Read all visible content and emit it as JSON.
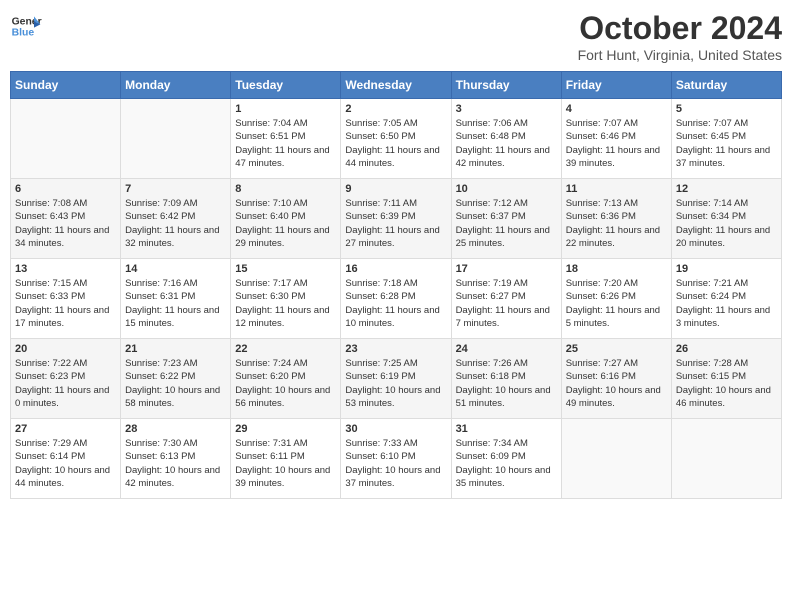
{
  "header": {
    "logo_line1": "General",
    "logo_line2": "Blue",
    "month": "October 2024",
    "location": "Fort Hunt, Virginia, United States"
  },
  "days_of_week": [
    "Sunday",
    "Monday",
    "Tuesday",
    "Wednesday",
    "Thursday",
    "Friday",
    "Saturday"
  ],
  "weeks": [
    [
      {
        "day": "",
        "empty": true
      },
      {
        "day": "",
        "empty": true
      },
      {
        "day": "1",
        "sunrise": "7:04 AM",
        "sunset": "6:51 PM",
        "daylight": "11 hours and 47 minutes."
      },
      {
        "day": "2",
        "sunrise": "7:05 AM",
        "sunset": "6:50 PM",
        "daylight": "11 hours and 44 minutes."
      },
      {
        "day": "3",
        "sunrise": "7:06 AM",
        "sunset": "6:48 PM",
        "daylight": "11 hours and 42 minutes."
      },
      {
        "day": "4",
        "sunrise": "7:07 AM",
        "sunset": "6:46 PM",
        "daylight": "11 hours and 39 minutes."
      },
      {
        "day": "5",
        "sunrise": "7:07 AM",
        "sunset": "6:45 PM",
        "daylight": "11 hours and 37 minutes."
      }
    ],
    [
      {
        "day": "6",
        "sunrise": "7:08 AM",
        "sunset": "6:43 PM",
        "daylight": "11 hours and 34 minutes."
      },
      {
        "day": "7",
        "sunrise": "7:09 AM",
        "sunset": "6:42 PM",
        "daylight": "11 hours and 32 minutes."
      },
      {
        "day": "8",
        "sunrise": "7:10 AM",
        "sunset": "6:40 PM",
        "daylight": "11 hours and 29 minutes."
      },
      {
        "day": "9",
        "sunrise": "7:11 AM",
        "sunset": "6:39 PM",
        "daylight": "11 hours and 27 minutes."
      },
      {
        "day": "10",
        "sunrise": "7:12 AM",
        "sunset": "6:37 PM",
        "daylight": "11 hours and 25 minutes."
      },
      {
        "day": "11",
        "sunrise": "7:13 AM",
        "sunset": "6:36 PM",
        "daylight": "11 hours and 22 minutes."
      },
      {
        "day": "12",
        "sunrise": "7:14 AM",
        "sunset": "6:34 PM",
        "daylight": "11 hours and 20 minutes."
      }
    ],
    [
      {
        "day": "13",
        "sunrise": "7:15 AM",
        "sunset": "6:33 PM",
        "daylight": "11 hours and 17 minutes."
      },
      {
        "day": "14",
        "sunrise": "7:16 AM",
        "sunset": "6:31 PM",
        "daylight": "11 hours and 15 minutes."
      },
      {
        "day": "15",
        "sunrise": "7:17 AM",
        "sunset": "6:30 PM",
        "daylight": "11 hours and 12 minutes."
      },
      {
        "day": "16",
        "sunrise": "7:18 AM",
        "sunset": "6:28 PM",
        "daylight": "11 hours and 10 minutes."
      },
      {
        "day": "17",
        "sunrise": "7:19 AM",
        "sunset": "6:27 PM",
        "daylight": "11 hours and 7 minutes."
      },
      {
        "day": "18",
        "sunrise": "7:20 AM",
        "sunset": "6:26 PM",
        "daylight": "11 hours and 5 minutes."
      },
      {
        "day": "19",
        "sunrise": "7:21 AM",
        "sunset": "6:24 PM",
        "daylight": "11 hours and 3 minutes."
      }
    ],
    [
      {
        "day": "20",
        "sunrise": "7:22 AM",
        "sunset": "6:23 PM",
        "daylight": "11 hours and 0 minutes."
      },
      {
        "day": "21",
        "sunrise": "7:23 AM",
        "sunset": "6:22 PM",
        "daylight": "10 hours and 58 minutes."
      },
      {
        "day": "22",
        "sunrise": "7:24 AM",
        "sunset": "6:20 PM",
        "daylight": "10 hours and 56 minutes."
      },
      {
        "day": "23",
        "sunrise": "7:25 AM",
        "sunset": "6:19 PM",
        "daylight": "10 hours and 53 minutes."
      },
      {
        "day": "24",
        "sunrise": "7:26 AM",
        "sunset": "6:18 PM",
        "daylight": "10 hours and 51 minutes."
      },
      {
        "day": "25",
        "sunrise": "7:27 AM",
        "sunset": "6:16 PM",
        "daylight": "10 hours and 49 minutes."
      },
      {
        "day": "26",
        "sunrise": "7:28 AM",
        "sunset": "6:15 PM",
        "daylight": "10 hours and 46 minutes."
      }
    ],
    [
      {
        "day": "27",
        "sunrise": "7:29 AM",
        "sunset": "6:14 PM",
        "daylight": "10 hours and 44 minutes."
      },
      {
        "day": "28",
        "sunrise": "7:30 AM",
        "sunset": "6:13 PM",
        "daylight": "10 hours and 42 minutes."
      },
      {
        "day": "29",
        "sunrise": "7:31 AM",
        "sunset": "6:11 PM",
        "daylight": "10 hours and 39 minutes."
      },
      {
        "day": "30",
        "sunrise": "7:33 AM",
        "sunset": "6:10 PM",
        "daylight": "10 hours and 37 minutes."
      },
      {
        "day": "31",
        "sunrise": "7:34 AM",
        "sunset": "6:09 PM",
        "daylight": "10 hours and 35 minutes."
      },
      {
        "day": "",
        "empty": true
      },
      {
        "day": "",
        "empty": true
      }
    ]
  ],
  "labels": {
    "sunrise_prefix": "Sunrise: ",
    "sunset_prefix": "Sunset: ",
    "daylight_prefix": "Daylight: "
  }
}
